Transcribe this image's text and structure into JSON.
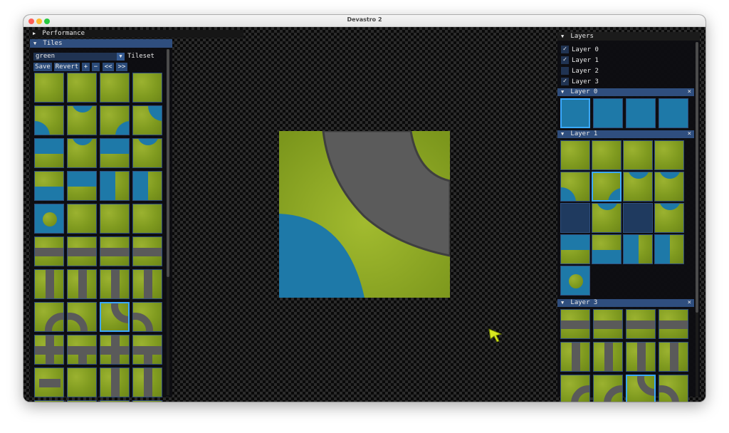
{
  "window": {
    "title": "Devastro 2"
  },
  "performance": {
    "label": "Performance"
  },
  "tiles_panel": {
    "title": "Tiles",
    "tileset_value": "green",
    "tileset_label": "Tileset",
    "buttons": {
      "save": "Save",
      "revert": "Revert",
      "add": "+",
      "remove": "−",
      "prev": "<<",
      "next": ">>"
    }
  },
  "layers_panel": {
    "title": "Layers",
    "layers": [
      {
        "name": "Layer 0",
        "checked": true
      },
      {
        "name": "Layer 1",
        "checked": true
      },
      {
        "name": "Layer 2",
        "checked": false
      },
      {
        "name": "Layer 3",
        "checked": true
      }
    ],
    "sections": [
      {
        "title": "Layer 0",
        "close": "×"
      },
      {
        "title": "Layer 1",
        "close": "×"
      },
      {
        "title": "Layer 3",
        "close": "×"
      }
    ]
  },
  "icons": {
    "expand": "triangle-down-icon",
    "collapse": "triangle-right-icon",
    "check": "✓"
  },
  "colors": {
    "accent": "#2f4e7e",
    "selected": "#3aa8ff",
    "grass": "#8aa326",
    "water": "#1e79a8",
    "road": "#5a5a5a"
  }
}
